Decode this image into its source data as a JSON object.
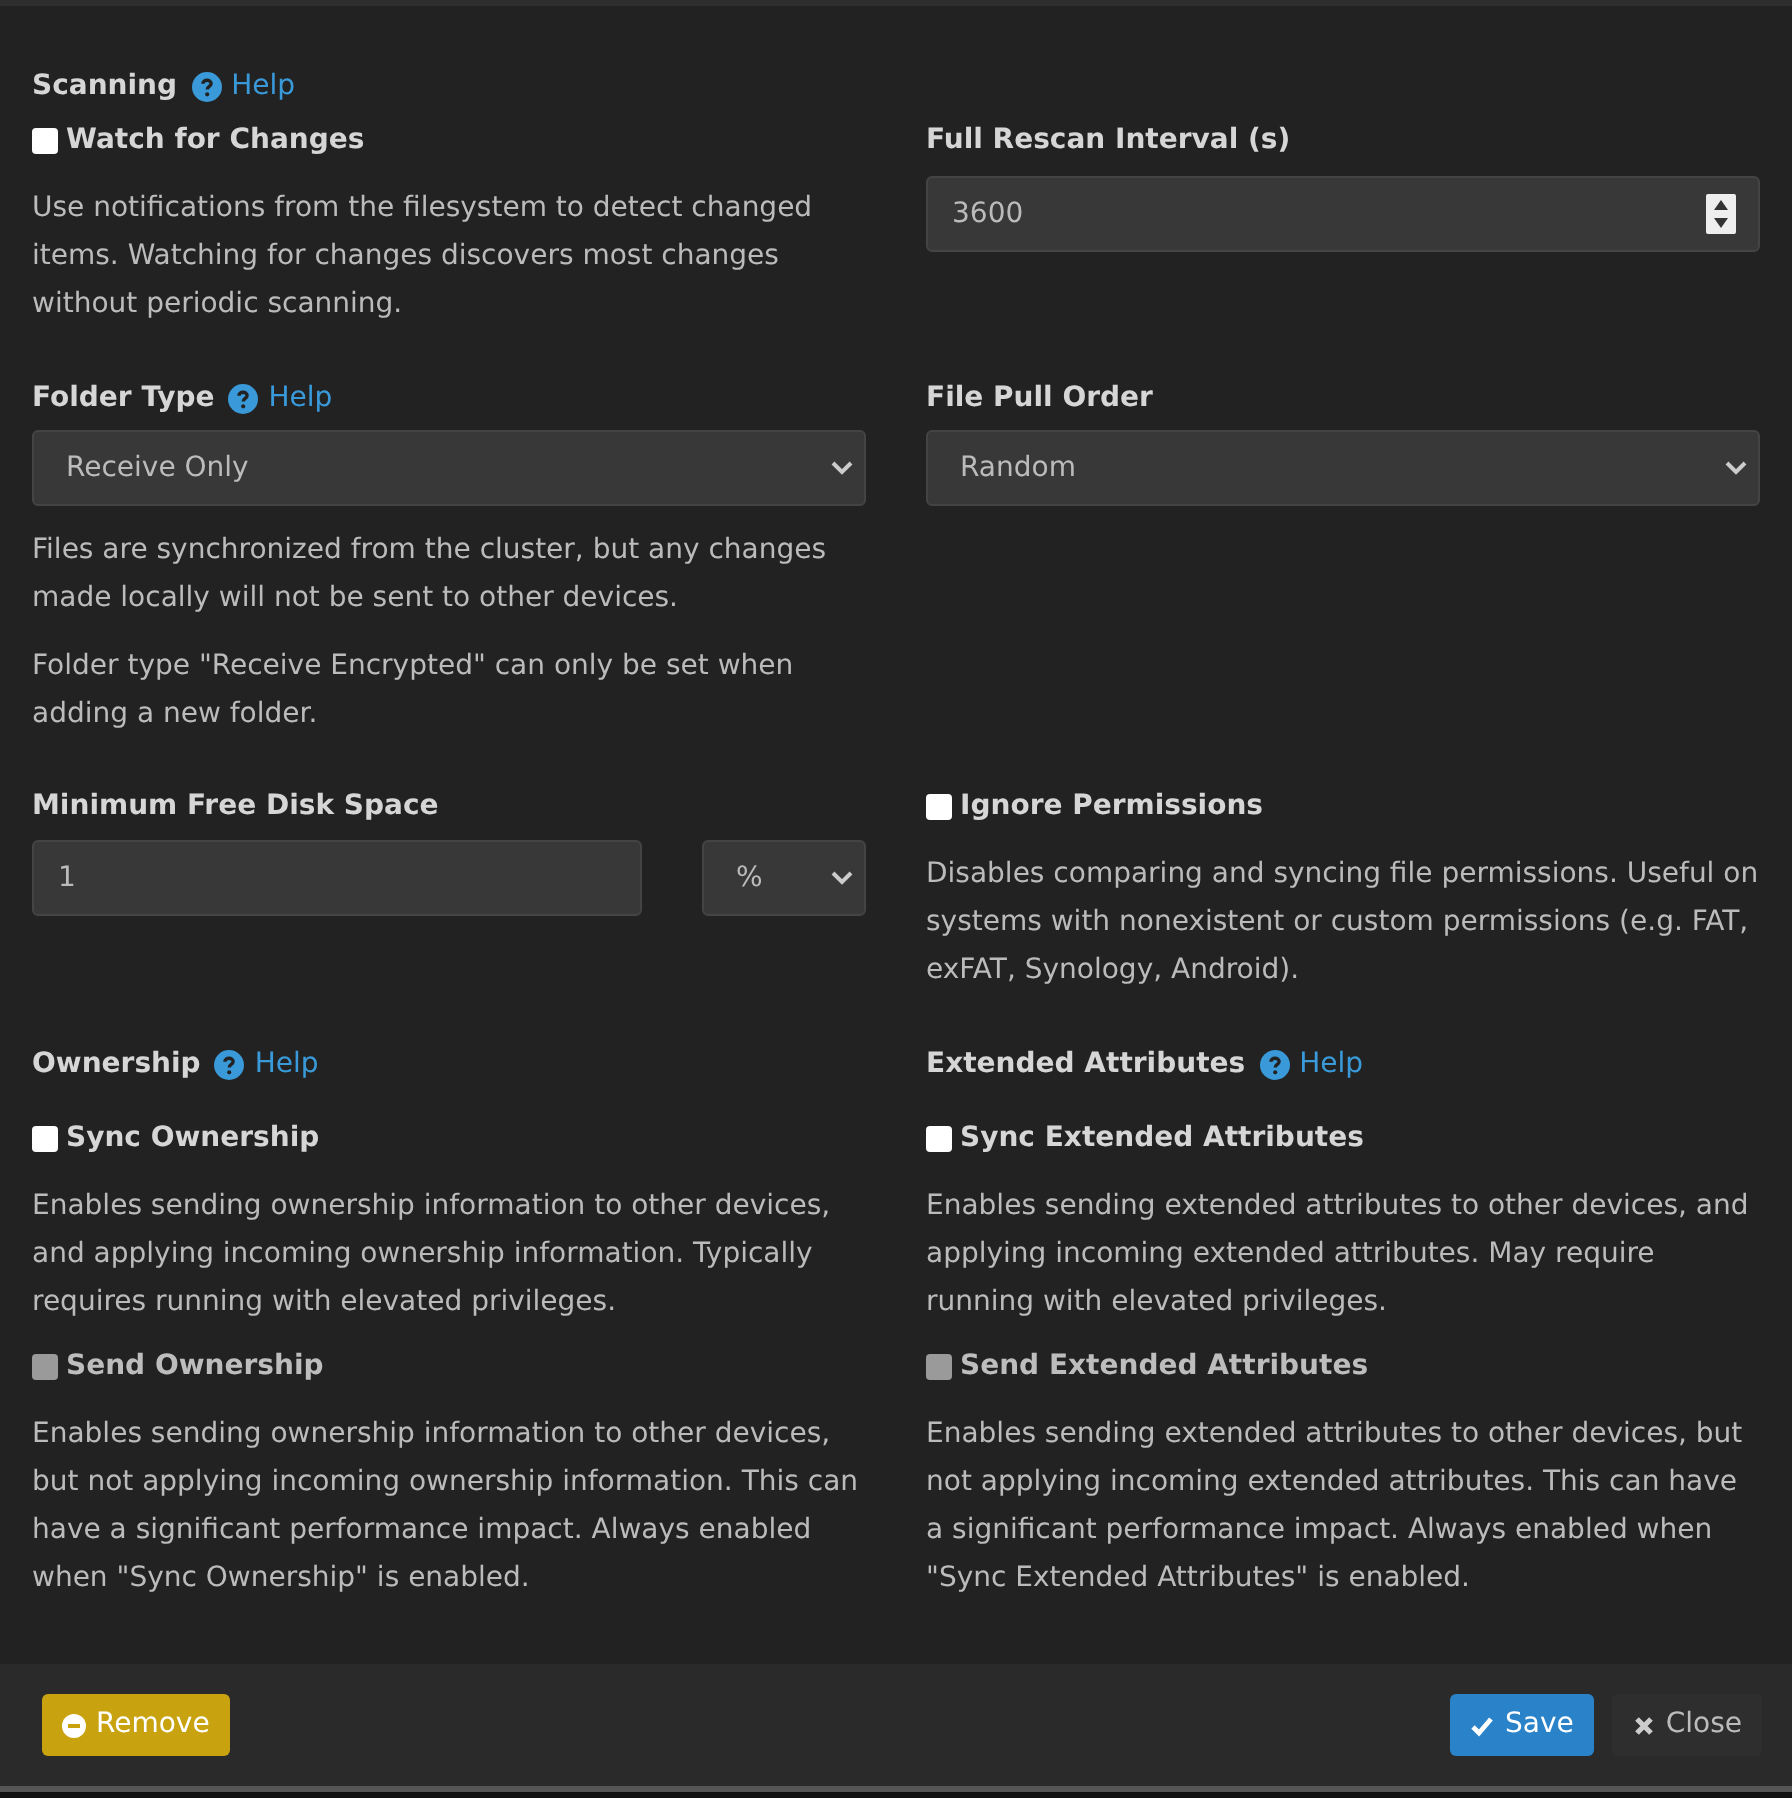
{
  "rows": [
    {
      "left": [
        {
          "kind": "heading",
          "label": "Scanning",
          "help": "Help"
        },
        {
          "kind": "checkbox",
          "label": "Watch for Changes",
          "checked": false,
          "disabled": false
        },
        {
          "kind": "note",
          "text": "Use notifications from the filesystem to detect changed items. Watching for changes discovers most changes without periodic scanning."
        }
      ],
      "right": [
        {
          "kind": "label",
          "label": "Full Rescan Interval (s)"
        },
        {
          "kind": "number",
          "value": "3600"
        }
      ]
    },
    {
      "left": [
        {
          "kind": "heading",
          "label": "Folder Type",
          "help": "Help"
        },
        {
          "kind": "select",
          "value": "Receive Only"
        },
        {
          "kind": "note",
          "text": "Files are synchronized from the cluster, but any changes made locally will not be sent to other devices."
        },
        {
          "kind": "note",
          "text": "Folder type \"Receive Encrypted\" can only be set when adding a new folder."
        }
      ],
      "right": [
        {
          "kind": "heading",
          "label": "File Pull Order"
        },
        {
          "kind": "select",
          "value": "Random"
        }
      ]
    },
    {
      "left": [
        {
          "kind": "label",
          "label": "Minimum Free Disk Space"
        },
        {
          "kind": "size",
          "value": "1",
          "unit": "%"
        }
      ],
      "right": [
        {
          "kind": "checkbox",
          "label": "Ignore Permissions",
          "checked": false,
          "disabled": false
        },
        {
          "kind": "note",
          "text": "Disables comparing and syncing file permissions. Useful on systems with nonexistent or custom permissions (e.g. FAT, exFAT, Synology, Android)."
        }
      ]
    },
    {
      "left": [
        {
          "kind": "heading",
          "label": "Ownership",
          "help": "Help"
        },
        {
          "kind": "checkbox",
          "label": "Sync Ownership",
          "checked": false,
          "disabled": false
        },
        {
          "kind": "note",
          "text": "Enables sending ownership information to other devices, and applying incoming ownership information. Typically requires running with elevated privileges."
        },
        {
          "kind": "checkbox",
          "label": "Send Ownership",
          "checked": false,
          "disabled": true
        },
        {
          "kind": "note",
          "text": "Enables sending ownership information to other devices, but not applying incoming ownership information. This can have a significant performance impact. Always enabled when \"Sync Ownership\" is enabled."
        }
      ],
      "right": [
        {
          "kind": "heading",
          "label": "Extended Attributes",
          "help": "Help"
        },
        {
          "kind": "checkbox",
          "label": "Sync Extended Attributes",
          "checked": false,
          "disabled": false
        },
        {
          "kind": "note",
          "text": "Enables sending extended attributes to other devices, and applying incoming extended attributes. May require running with elevated privileges."
        },
        {
          "kind": "checkbox",
          "label": "Send Extended Attributes",
          "checked": false,
          "disabled": true
        },
        {
          "kind": "note",
          "text": "Enables sending extended attributes to other devices, but not applying incoming extended attributes. This can have a significant performance impact. Always enabled when \"Sync Extended Attributes\" is enabled."
        }
      ]
    }
  ],
  "footer": {
    "left": [
      {
        "kind": "remove",
        "label": "Remove"
      }
    ],
    "right": [
      {
        "kind": "save",
        "label": "Save"
      },
      {
        "kind": "close",
        "label": "Close"
      }
    ]
  }
}
